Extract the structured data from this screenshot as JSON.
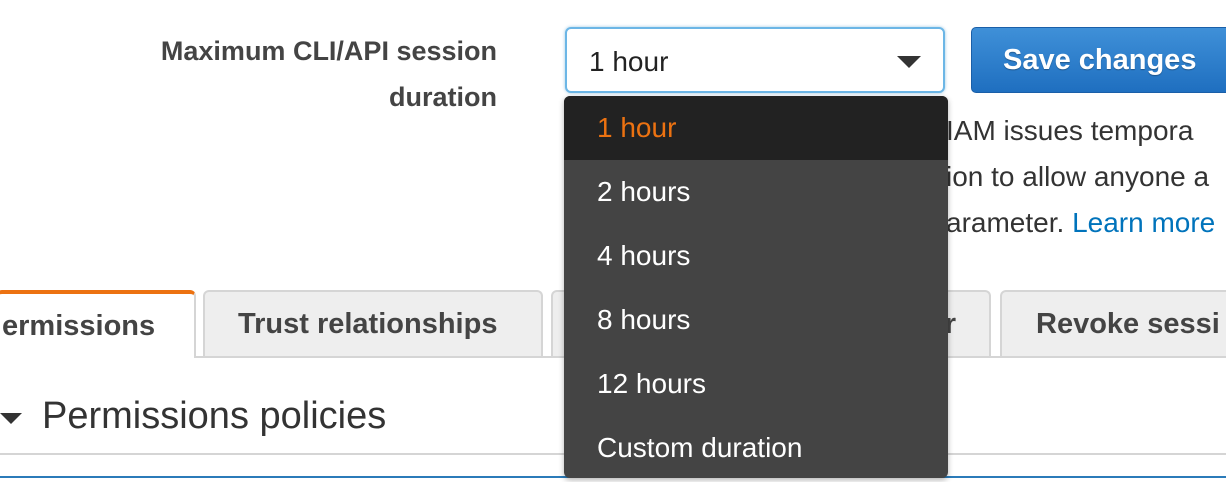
{
  "setting": {
    "label_line1": "Maximum CLI/API session",
    "label_line2": "duration",
    "selected_value": "1 hour",
    "save_label": "Save changes"
  },
  "description": {
    "line1": "IAM issues tempora",
    "line2": "ion to allow anyone a",
    "line3_prefix": "arameter. ",
    "learn_more": "Learn more"
  },
  "dropdown": {
    "options": [
      "1 hour",
      "2 hours",
      "4 hours",
      "8 hours",
      "12 hours",
      "Custom duration"
    ]
  },
  "tabs": [
    {
      "label": "ermissions",
      "active": true
    },
    {
      "label": "Trust relationships",
      "active": false
    },
    {
      "label": "r",
      "active": false
    },
    {
      "label": "Revoke sessi",
      "active": false
    }
  ],
  "section": {
    "title": "Permissions policies"
  },
  "colors": {
    "accent_orange": "#ec7211",
    "primary_blue": "#1f6fc0",
    "link_blue": "#0073bb",
    "dropdown_bg": "#444444"
  }
}
